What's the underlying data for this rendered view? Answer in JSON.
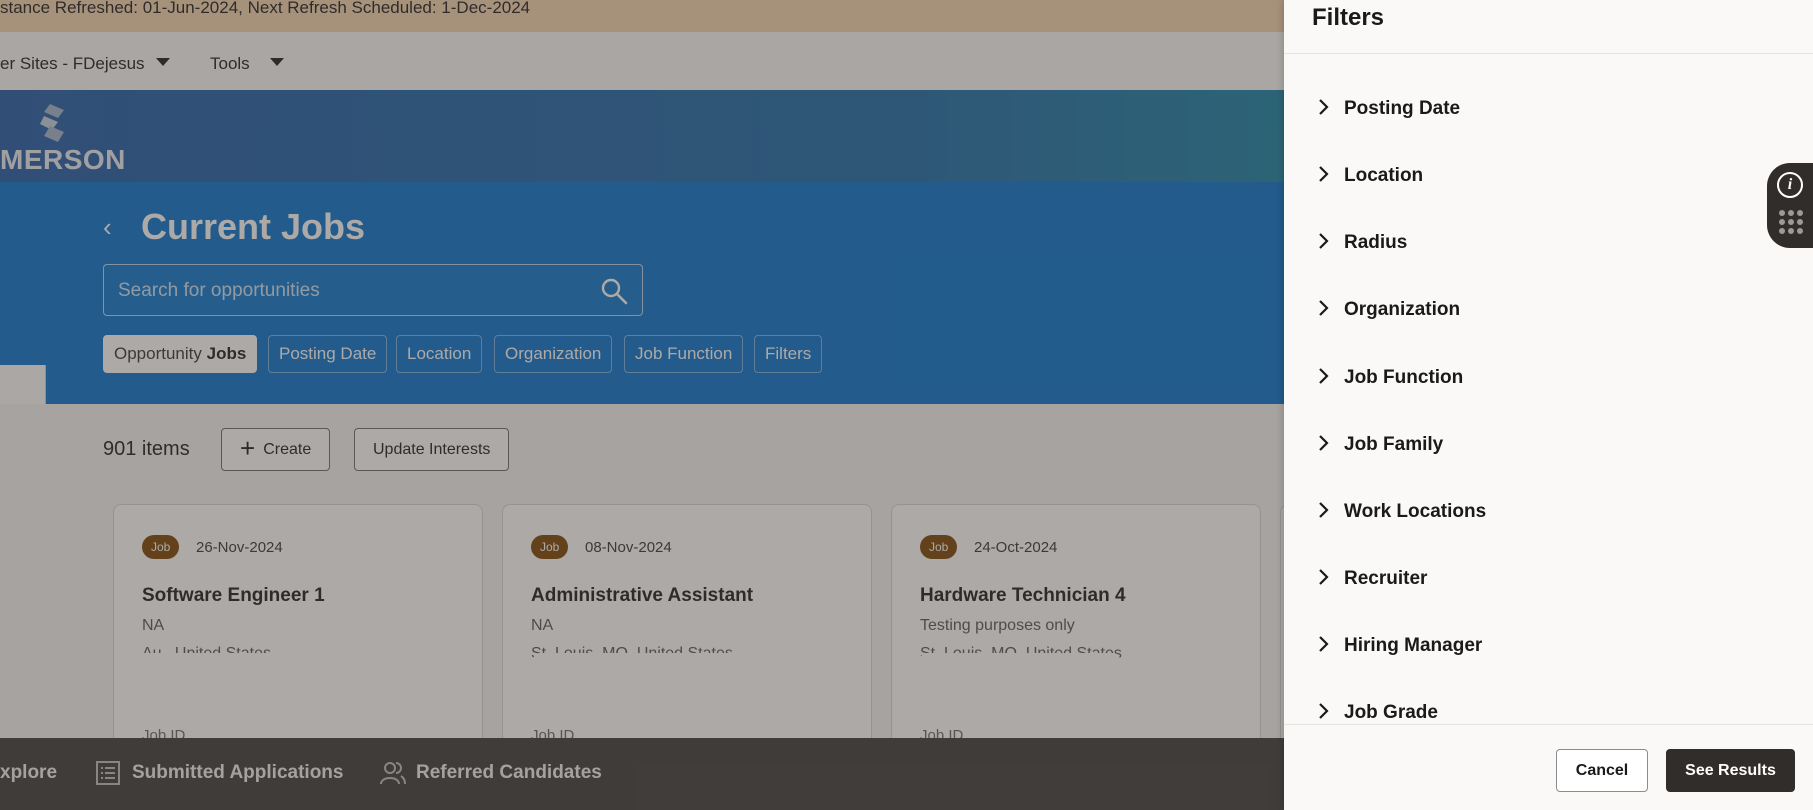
{
  "banner": {
    "text": "stance Refreshed: 01-Jun-2024, Next Refresh Scheduled: 1-Dec-2024"
  },
  "topnav": {
    "sites_label": "er Sites - FDejesus",
    "tools_label": "Tools"
  },
  "brand": {
    "logo_text": "MERSON"
  },
  "hero": {
    "back_glyph": "‹",
    "title": "Current Jobs",
    "search_placeholder": "Search for opportunities",
    "chips": {
      "opportunity_prefix": "Opportunity",
      "opportunity_value": "Jobs",
      "posting_date": "Posting Date",
      "location": "Location",
      "organization": "Organization",
      "job_function": "Job Function",
      "filters": "Filters"
    }
  },
  "results": {
    "count": "901 items",
    "create_label": "Create",
    "update_interests_label": "Update Interests"
  },
  "cards": [
    {
      "badge": "Job",
      "date": "26-Nov-2024",
      "title": "Software Engineer 1",
      "org": "NA",
      "location": "Au       , United States",
      "job_id_label": "Job ID"
    },
    {
      "badge": "Job",
      "date": "08-Nov-2024",
      "title": "Administrative Assistant",
      "org": "NA",
      "location": "St. Louis, MO, United States",
      "job_id_label": "Job ID"
    },
    {
      "badge": "Job",
      "date": "24-Oct-2024",
      "title": "Hardware Technician 4",
      "org": "Testing purposes only",
      "location": "St. Louis, MO, United States",
      "job_id_label": "Job ID"
    }
  ],
  "bottombar": {
    "explore": "xplore",
    "submitted": "Submitted Applications",
    "referred": "Referred Candidates"
  },
  "filters_panel": {
    "title": "Filters",
    "items": [
      "Posting Date",
      "Location",
      "Radius",
      "Organization",
      "Job Function",
      "Job Family",
      "Work Locations",
      "Recruiter",
      "Hiring Manager",
      "Job Grade"
    ],
    "cancel_label": "Cancel",
    "see_results_label": "See Results"
  },
  "colors": {
    "hero_blue": "#0572ce",
    "badge_brown": "#7a4400",
    "dark_button": "#312d2a",
    "bottom_bar": "#3b3a39"
  },
  "icons": [
    "chevron-down-icon",
    "back-chevron-icon",
    "search-icon",
    "plus-icon",
    "list-icon",
    "people-icon",
    "chevron-right-icon",
    "info-icon",
    "grid-icon",
    "logo-mark-icon"
  ]
}
